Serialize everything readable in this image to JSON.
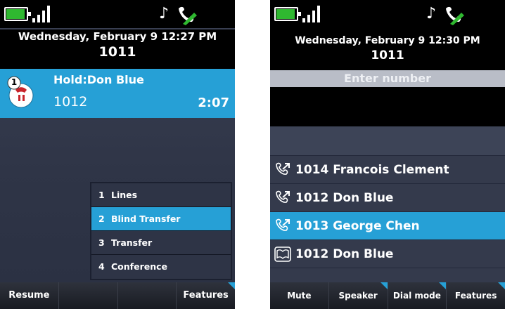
{
  "left_screen": {
    "status": {
      "icons": [
        "battery-icon",
        "signal-icon",
        "music-note-icon",
        "handset-icon"
      ]
    },
    "date": "Wednesday, February 9 12:27 PM",
    "line": "1011",
    "call": {
      "badge": "1",
      "name": "Hold:Don Blue",
      "number": "1012",
      "time": "2:07"
    },
    "menu": [
      {
        "num": "1",
        "label": "Lines"
      },
      {
        "num": "2",
        "label": "Blind Transfer",
        "selected": true
      },
      {
        "num": "3",
        "label": "Transfer"
      },
      {
        "num": "4",
        "label": "Conference"
      }
    ],
    "softkeys": [
      "Resume",
      "",
      "",
      "Features"
    ]
  },
  "right_screen": {
    "status": {
      "icons": [
        "battery-icon",
        "signal-icon",
        "music-note-icon",
        "handset-icon"
      ]
    },
    "date": "Wednesday, February 9 12:30 PM",
    "line": "1011",
    "enter_label": "Enter number",
    "list": [
      {
        "icon": "outgoing-call-icon",
        "text": "1014 Francois Clement"
      },
      {
        "icon": "outgoing-call-icon",
        "text": "1012 Don Blue"
      },
      {
        "icon": "outgoing-call-icon",
        "text": "1013 George Chen",
        "selected": true
      },
      {
        "icon": "directory-book-icon",
        "text": "1012 Don Blue"
      }
    ],
    "softkeys": [
      "Mute",
      "Speaker",
      "Dial mode",
      "Features"
    ]
  },
  "colors": {
    "accent": "#26a0d6",
    "battery": "#2fb830",
    "background": "#2f3547"
  }
}
